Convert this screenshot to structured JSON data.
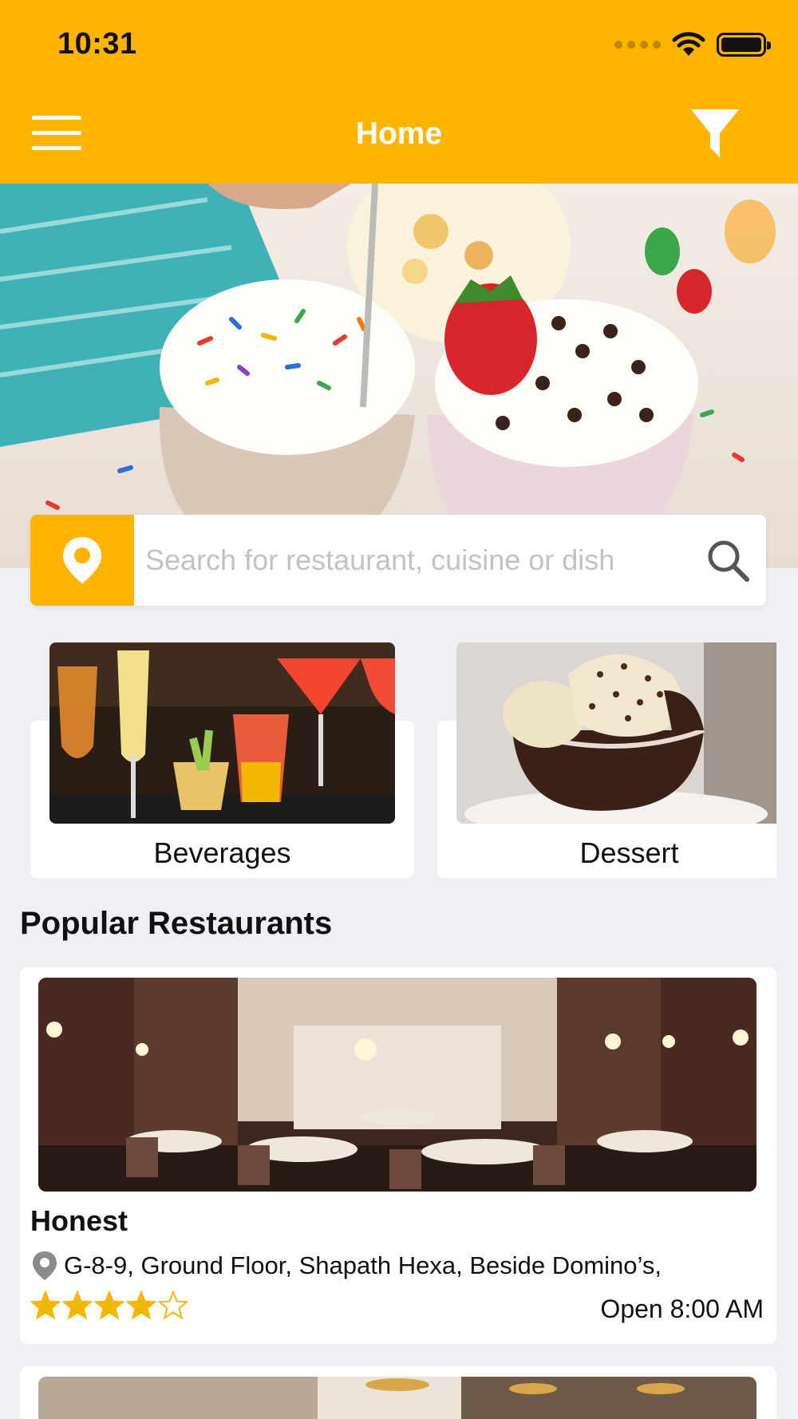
{
  "status_bar": {
    "time": "10:31"
  },
  "header": {
    "title": "Home"
  },
  "search": {
    "placeholder": "Search for restaurant, cuisine or dish"
  },
  "categories": [
    {
      "label": "Beverages"
    },
    {
      "label": "Dessert"
    }
  ],
  "popular": {
    "title": "Popular Restaurants",
    "restaurants": [
      {
        "name": "Honest",
        "address": "G-8-9, Ground Floor, Shapath Hexa, Beside Domino’s,",
        "rating": 4,
        "rating_max": 5,
        "open_text": "Open 8:00 AM"
      }
    ]
  },
  "colors": {
    "accent": "#ffb400",
    "background": "#f0eff4",
    "star": "#f2b705"
  },
  "icons": [
    "menu-icon",
    "filter-icon",
    "location-pin-icon",
    "search-icon",
    "address-pin-icon",
    "star-icon"
  ]
}
